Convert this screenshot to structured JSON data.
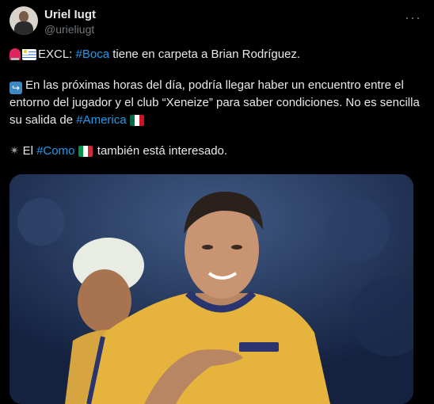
{
  "tweet": {
    "author_name": "Uriel Iugt",
    "handle": "@urieliugt",
    "more_icon": "more-horizontal-icon",
    "line1": {
      "prefix": "EXCL: ",
      "hashtag": "#Boca",
      "rest": " tiene en carpeta a Brian Rodríguez."
    },
    "para2": {
      "text": "En las próximas horas del día, podría llegar haber un encuentro entre el entorno del jugador y el club “Xeneize” para saber condiciones. No es sencilla su salida de ",
      "hashtag": "#America"
    },
    "para3": {
      "prefix": "El ",
      "hashtag": "#Como",
      "rest": " también está interesado."
    }
  },
  "colors": {
    "background": "#000000",
    "text": "#e7e9ea",
    "muted": "#71767b",
    "hashtag": "#1d9bf0",
    "jersey": "#e6b43c"
  }
}
